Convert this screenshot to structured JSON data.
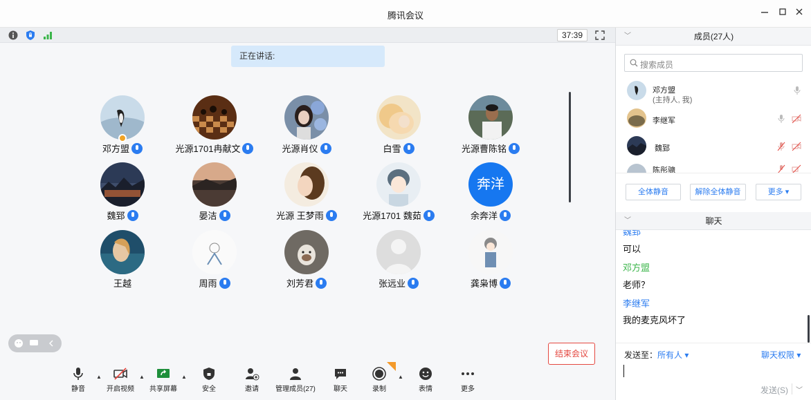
{
  "window": {
    "title": "腾讯会议"
  },
  "status": {
    "timer": "37:39"
  },
  "speaking": {
    "text": "正在讲话:"
  },
  "participants": [
    {
      "name": "邓方盟",
      "host": true
    },
    {
      "name": "光源1701冉献文"
    },
    {
      "name": "光源肖仪"
    },
    {
      "name": "白雪"
    },
    {
      "name": "光源曹陈铭"
    },
    {
      "name": "魏郅"
    },
    {
      "name": "晏洁"
    },
    {
      "name": "光源 王梦雨"
    },
    {
      "name": "光源1701 魏茹"
    },
    {
      "name": "余奔洋",
      "avatar_text": "奔洋"
    },
    {
      "name": "王越"
    },
    {
      "name": "周雨"
    },
    {
      "name": "刘芳君"
    },
    {
      "name": "张远业"
    },
    {
      "name": "龚枭博"
    }
  ],
  "toolbar": {
    "mute": "静音",
    "video": "开启视频",
    "share": "共享屏幕",
    "security": "安全",
    "invite": "邀请",
    "manage": "管理成员(27)",
    "chat": "聊天",
    "record": "录制",
    "emoji": "表情",
    "more": "更多",
    "end": "结束会议"
  },
  "members": {
    "header": "成员(27人)",
    "search_placeholder": "搜索成员",
    "list": [
      {
        "name": "邓方盟",
        "role": "(主持人, 我)"
      },
      {
        "name": "李继军"
      },
      {
        "name": "魏郅"
      },
      {
        "name": "陈彤骢"
      }
    ],
    "mute_all": "全体静音",
    "unmute_all": "解除全体静音",
    "more": "更多"
  },
  "chat": {
    "header": "聊天",
    "messages": [
      {
        "sender": "魏郅",
        "text": "可以"
      },
      {
        "sender": "邓方盟",
        "text": "老师？"
      },
      {
        "sender": "李继军",
        "text": "我的麦克风坏了"
      }
    ],
    "send_to_label": "发送至：",
    "send_to_value": "所有人",
    "permission": "聊天权限",
    "send": "发送(S)"
  },
  "colors": {
    "accent": "#2b7cf0",
    "end": "#e4473f",
    "sender_green": "#3bb54a",
    "sender_blue": "#2b7cf0"
  }
}
